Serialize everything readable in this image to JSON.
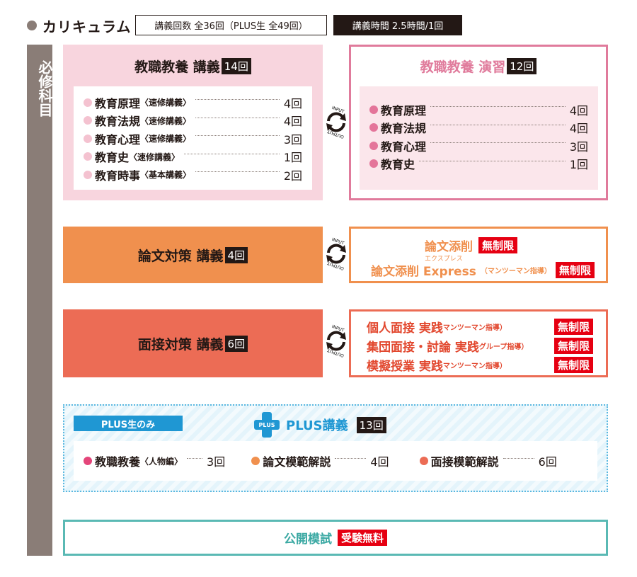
{
  "header": {
    "title": "カリキュラム",
    "lecture_count": "講義回数 全36回（PLUS生 全49回）",
    "lecture_time": "講義時間 2.5時間/1回"
  },
  "side_label": "必修科目",
  "cycle": {
    "input": "INPUT",
    "output": "OUTPUT"
  },
  "kyoshoku_lecture": {
    "title": "教職教養 講義",
    "count": "14回",
    "items": [
      {
        "name": "教育原理",
        "sub": "〈速修講義〉",
        "count": "4回"
      },
      {
        "name": "教育法規",
        "sub": "〈速修講義〉",
        "count": "4回"
      },
      {
        "name": "教育心理",
        "sub": "〈速修講義〉",
        "count": "3回"
      },
      {
        "name": "教育史",
        "sub": "〈速修講義〉",
        "count": "1回"
      },
      {
        "name": "教育時事",
        "sub": "〈基本講義〉",
        "count": "2回"
      }
    ]
  },
  "kyoshoku_practice": {
    "title": "教職教養 演習",
    "count": "12回",
    "items": [
      {
        "name": "教育原理",
        "count": "4回"
      },
      {
        "name": "教育法規",
        "count": "4回"
      },
      {
        "name": "教育心理",
        "count": "3回"
      },
      {
        "name": "教育史",
        "count": "1回"
      }
    ]
  },
  "ronbun_lecture": {
    "title": "論文対策 講義",
    "count": "4回"
  },
  "ronbun_output": {
    "line1": "論文添削",
    "line1_tag": "無制限",
    "ruby": "エクスプレス",
    "line2": "論文添削 Express",
    "line2_sub": "（マンツーマン指導）",
    "line2_tag": "無制限"
  },
  "mensetsu_lecture": {
    "title": "面接対策 講義",
    "count": "6回"
  },
  "mensetsu_output": [
    {
      "name": "個人面接 実践",
      "sub": "マンツーマン指導）",
      "tag": "無制限"
    },
    {
      "name": "集団面接・討論 実践",
      "sub": "グループ指導）",
      "tag": "無制限"
    },
    {
      "name": "模擬授業 実践",
      "sub": "マンツーマン指導）",
      "tag": "無制限"
    }
  ],
  "plus": {
    "label": "PLUS生のみ",
    "icon_text": "PLUS",
    "title": "PLUS講義",
    "count": "13回",
    "items": [
      {
        "name": "教職教養",
        "sub": "〈人物編〉",
        "count": "3回",
        "color": "#e4457a"
      },
      {
        "name": "論文模範解説",
        "sub": "",
        "count": "4回",
        "color": "#f0904e"
      },
      {
        "name": "面接模範解説",
        "sub": "",
        "count": "6回",
        "color": "#ec6c55"
      }
    ]
  },
  "mock": {
    "title": "公開模試",
    "tag": "受験無料"
  },
  "colors": {
    "pink": "#e07b9c",
    "orange": "#f0904e",
    "red": "#ec6c55",
    "blue": "#1f97d3",
    "teal": "#5ab9b4",
    "brand_red": "#e60012"
  }
}
